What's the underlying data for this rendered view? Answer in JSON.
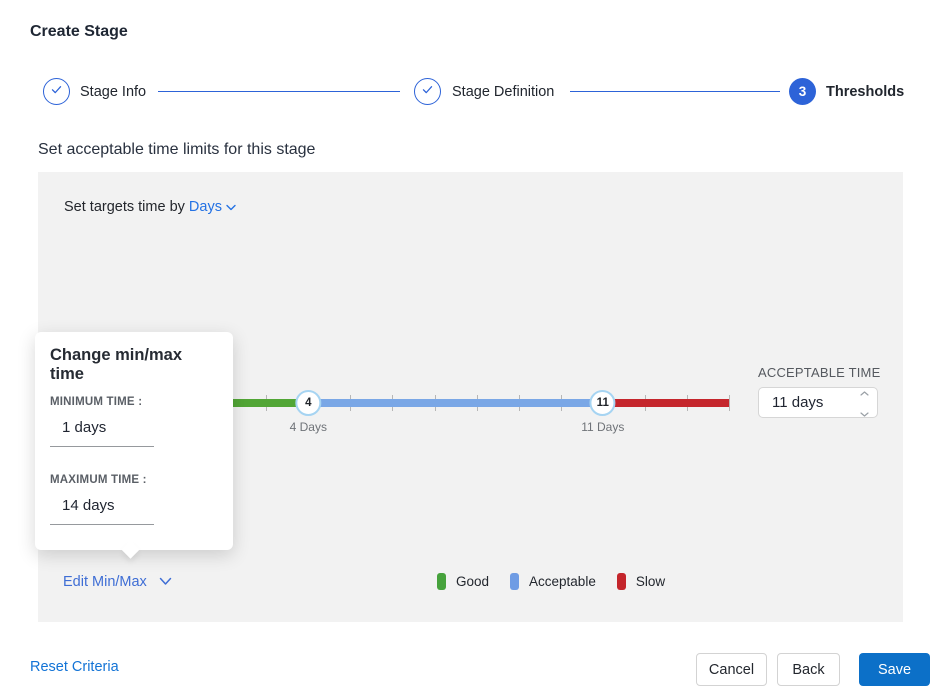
{
  "title": "Create Stage",
  "stepper": {
    "steps": [
      {
        "label": "Stage Info",
        "state": "done"
      },
      {
        "label": "Stage Definition",
        "state": "done"
      },
      {
        "label": "Thresholds",
        "state": "active",
        "number": "3"
      }
    ]
  },
  "heading": "Set acceptable time limits for this stage",
  "panel": {
    "set_targets_prefix": "Set targets time by",
    "unit_dropdown": {
      "value": "Days"
    },
    "acceptable_time": {
      "label": "ACCEPTABLE TIME",
      "value": "11 days"
    },
    "edit_minmax_label": "Edit Min/Max"
  },
  "slider": {
    "unit": "Days",
    "range_min": 0,
    "range_max": 14,
    "tick_step": 1,
    "handles": [
      {
        "value": 4,
        "label": "4 Days"
      },
      {
        "value": 11,
        "label": "11 Days"
      }
    ],
    "segments": [
      {
        "name": "good",
        "from": 0,
        "to": 4,
        "color": "#52a636"
      },
      {
        "name": "acceptable",
        "from": 4,
        "to": 11,
        "color": "#7aa7e6"
      },
      {
        "name": "slow",
        "from": 11,
        "to": 14,
        "color": "#c5262c"
      }
    ]
  },
  "popover": {
    "title": "Change min/max time",
    "minimum": {
      "label": "MINIMUM TIME :",
      "value": "1 days"
    },
    "maximum": {
      "label": "MAXIMUM TIME :",
      "value": "14 days"
    }
  },
  "legend": [
    {
      "label": "Good",
      "color": "#46a23c"
    },
    {
      "label": "Acceptable",
      "color": "#6f9ce4"
    },
    {
      "label": "Slow",
      "color": "#c4252b"
    }
  ],
  "footer": {
    "reset": "Reset Criteria",
    "cancel": "Cancel",
    "back": "Back",
    "save": "Save"
  },
  "colors": {
    "accent_blue": "#2d63d8",
    "link_blue": "#2472e4",
    "save_blue": "#0c70c8",
    "panel_bg": "#f2f2f2",
    "handle_border": "#a6d4f2",
    "tick_gray": "#b6b6b6"
  }
}
